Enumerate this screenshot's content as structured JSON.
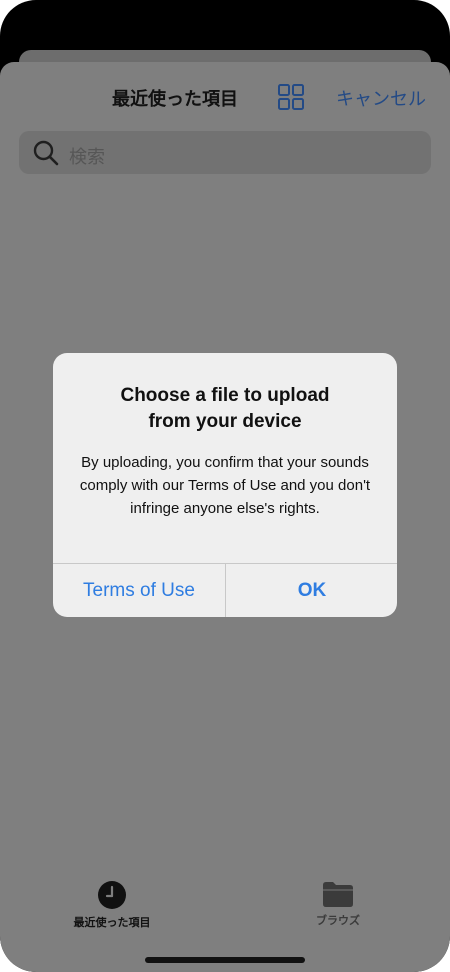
{
  "nav": {
    "title": "最近使った項目",
    "cancel_label": "キャンセル"
  },
  "search": {
    "placeholder": "検索"
  },
  "alert": {
    "title_line1": "Choose a file to upload",
    "title_line2": "from your device",
    "message": "By uploading, you confirm that your sounds comply with our Terms of Use and you don't infringe anyone else's rights.",
    "left_button": "Terms of Use",
    "right_button": "OK"
  },
  "tabs": [
    {
      "label": "最近使った項目",
      "icon": "clock-icon",
      "selected": true
    },
    {
      "label": "ブラウズ",
      "icon": "folder-icon",
      "selected": false
    }
  ],
  "colors": {
    "accent": "#2f7de1",
    "dimmed_accent": "#234a86",
    "overlay": "#7f7f7f"
  }
}
